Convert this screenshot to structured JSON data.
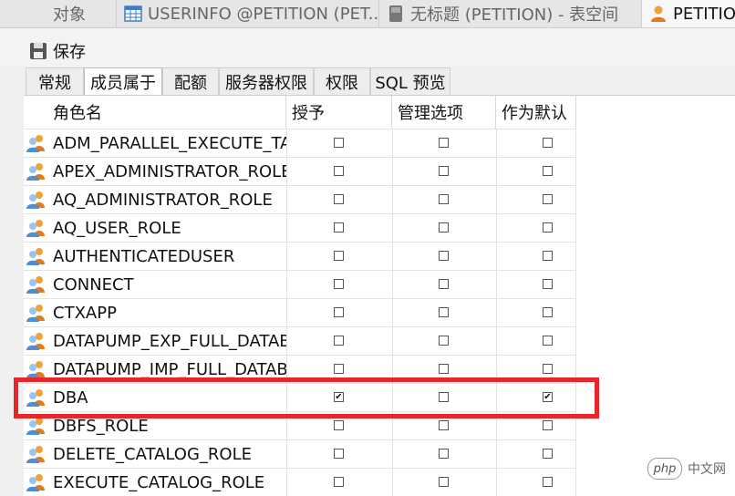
{
  "tabs": [
    {
      "label": "对象",
      "icon": "none"
    },
    {
      "label": "USERINFO @PETITION (PET...",
      "icon": "table-icon"
    },
    {
      "label": "无标题 (PETITION) - 表空间",
      "icon": "tablespace-icon"
    },
    {
      "label": "PETITION",
      "icon": "user-icon"
    }
  ],
  "toolbar": {
    "save_label": "保存"
  },
  "subtabs": [
    "常规",
    "成员属于",
    "配额",
    "服务器权限",
    "权限",
    "SQL 预览"
  ],
  "columns": [
    "角色名",
    "授予",
    "管理选项",
    "作为默认"
  ],
  "rows": [
    {
      "name": "ADM_PARALLEL_EXECUTE_TASK",
      "grant": false,
      "admin": false,
      "default": false
    },
    {
      "name": "APEX_ADMINISTRATOR_ROLE",
      "grant": false,
      "admin": false,
      "default": false
    },
    {
      "name": "AQ_ADMINISTRATOR_ROLE",
      "grant": false,
      "admin": false,
      "default": false
    },
    {
      "name": "AQ_USER_ROLE",
      "grant": false,
      "admin": false,
      "default": false
    },
    {
      "name": "AUTHENTICATEDUSER",
      "grant": false,
      "admin": false,
      "default": false
    },
    {
      "name": "CONNECT",
      "grant": false,
      "admin": false,
      "default": false
    },
    {
      "name": "CTXAPP",
      "grant": false,
      "admin": false,
      "default": false
    },
    {
      "name": "DATAPUMP_EXP_FULL_DATABASE",
      "grant": false,
      "admin": false,
      "default": false
    },
    {
      "name": "DATAPUMP_IMP_FULL_DATABASE",
      "grant": false,
      "admin": false,
      "default": false
    },
    {
      "name": "DBA",
      "grant": true,
      "admin": false,
      "default": true
    },
    {
      "name": "DBFS_ROLE",
      "grant": false,
      "admin": false,
      "default": false
    },
    {
      "name": "DELETE_CATALOG_ROLE",
      "grant": false,
      "admin": false,
      "default": false
    },
    {
      "name": "EXECUTE_CATALOG_ROLE",
      "grant": false,
      "admin": false,
      "default": false
    }
  ],
  "watermark": {
    "logo": "php",
    "text": "中文网"
  },
  "colors": {
    "highlight": "#e8262a"
  }
}
